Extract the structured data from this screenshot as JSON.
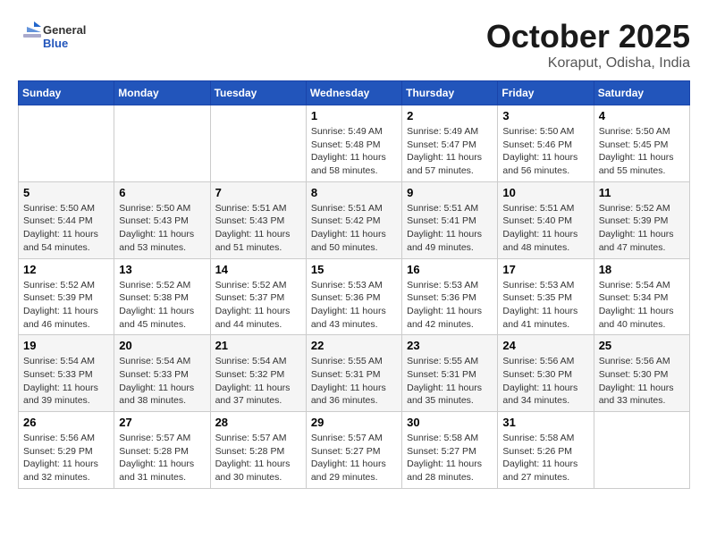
{
  "logo": {
    "text_general": "General",
    "text_blue": "Blue"
  },
  "header": {
    "month": "October 2025",
    "location": "Koraput, Odisha, India"
  },
  "weekdays": [
    "Sunday",
    "Monday",
    "Tuesday",
    "Wednesday",
    "Thursday",
    "Friday",
    "Saturday"
  ],
  "weeks": [
    [
      {
        "day": "",
        "info": ""
      },
      {
        "day": "",
        "info": ""
      },
      {
        "day": "",
        "info": ""
      },
      {
        "day": "1",
        "info": "Sunrise: 5:49 AM\nSunset: 5:48 PM\nDaylight: 11 hours\nand 58 minutes."
      },
      {
        "day": "2",
        "info": "Sunrise: 5:49 AM\nSunset: 5:47 PM\nDaylight: 11 hours\nand 57 minutes."
      },
      {
        "day": "3",
        "info": "Sunrise: 5:50 AM\nSunset: 5:46 PM\nDaylight: 11 hours\nand 56 minutes."
      },
      {
        "day": "4",
        "info": "Sunrise: 5:50 AM\nSunset: 5:45 PM\nDaylight: 11 hours\nand 55 minutes."
      }
    ],
    [
      {
        "day": "5",
        "info": "Sunrise: 5:50 AM\nSunset: 5:44 PM\nDaylight: 11 hours\nand 54 minutes."
      },
      {
        "day": "6",
        "info": "Sunrise: 5:50 AM\nSunset: 5:43 PM\nDaylight: 11 hours\nand 53 minutes."
      },
      {
        "day": "7",
        "info": "Sunrise: 5:51 AM\nSunset: 5:43 PM\nDaylight: 11 hours\nand 51 minutes."
      },
      {
        "day": "8",
        "info": "Sunrise: 5:51 AM\nSunset: 5:42 PM\nDaylight: 11 hours\nand 50 minutes."
      },
      {
        "day": "9",
        "info": "Sunrise: 5:51 AM\nSunset: 5:41 PM\nDaylight: 11 hours\nand 49 minutes."
      },
      {
        "day": "10",
        "info": "Sunrise: 5:51 AM\nSunset: 5:40 PM\nDaylight: 11 hours\nand 48 minutes."
      },
      {
        "day": "11",
        "info": "Sunrise: 5:52 AM\nSunset: 5:39 PM\nDaylight: 11 hours\nand 47 minutes."
      }
    ],
    [
      {
        "day": "12",
        "info": "Sunrise: 5:52 AM\nSunset: 5:39 PM\nDaylight: 11 hours\nand 46 minutes."
      },
      {
        "day": "13",
        "info": "Sunrise: 5:52 AM\nSunset: 5:38 PM\nDaylight: 11 hours\nand 45 minutes."
      },
      {
        "day": "14",
        "info": "Sunrise: 5:52 AM\nSunset: 5:37 PM\nDaylight: 11 hours\nand 44 minutes."
      },
      {
        "day": "15",
        "info": "Sunrise: 5:53 AM\nSunset: 5:36 PM\nDaylight: 11 hours\nand 43 minutes."
      },
      {
        "day": "16",
        "info": "Sunrise: 5:53 AM\nSunset: 5:36 PM\nDaylight: 11 hours\nand 42 minutes."
      },
      {
        "day": "17",
        "info": "Sunrise: 5:53 AM\nSunset: 5:35 PM\nDaylight: 11 hours\nand 41 minutes."
      },
      {
        "day": "18",
        "info": "Sunrise: 5:54 AM\nSunset: 5:34 PM\nDaylight: 11 hours\nand 40 minutes."
      }
    ],
    [
      {
        "day": "19",
        "info": "Sunrise: 5:54 AM\nSunset: 5:33 PM\nDaylight: 11 hours\nand 39 minutes."
      },
      {
        "day": "20",
        "info": "Sunrise: 5:54 AM\nSunset: 5:33 PM\nDaylight: 11 hours\nand 38 minutes."
      },
      {
        "day": "21",
        "info": "Sunrise: 5:54 AM\nSunset: 5:32 PM\nDaylight: 11 hours\nand 37 minutes."
      },
      {
        "day": "22",
        "info": "Sunrise: 5:55 AM\nSunset: 5:31 PM\nDaylight: 11 hours\nand 36 minutes."
      },
      {
        "day": "23",
        "info": "Sunrise: 5:55 AM\nSunset: 5:31 PM\nDaylight: 11 hours\nand 35 minutes."
      },
      {
        "day": "24",
        "info": "Sunrise: 5:56 AM\nSunset: 5:30 PM\nDaylight: 11 hours\nand 34 minutes."
      },
      {
        "day": "25",
        "info": "Sunrise: 5:56 AM\nSunset: 5:30 PM\nDaylight: 11 hours\nand 33 minutes."
      }
    ],
    [
      {
        "day": "26",
        "info": "Sunrise: 5:56 AM\nSunset: 5:29 PM\nDaylight: 11 hours\nand 32 minutes."
      },
      {
        "day": "27",
        "info": "Sunrise: 5:57 AM\nSunset: 5:28 PM\nDaylight: 11 hours\nand 31 minutes."
      },
      {
        "day": "28",
        "info": "Sunrise: 5:57 AM\nSunset: 5:28 PM\nDaylight: 11 hours\nand 30 minutes."
      },
      {
        "day": "29",
        "info": "Sunrise: 5:57 AM\nSunset: 5:27 PM\nDaylight: 11 hours\nand 29 minutes."
      },
      {
        "day": "30",
        "info": "Sunrise: 5:58 AM\nSunset: 5:27 PM\nDaylight: 11 hours\nand 28 minutes."
      },
      {
        "day": "31",
        "info": "Sunrise: 5:58 AM\nSunset: 5:26 PM\nDaylight: 11 hours\nand 27 minutes."
      },
      {
        "day": "",
        "info": ""
      }
    ]
  ]
}
